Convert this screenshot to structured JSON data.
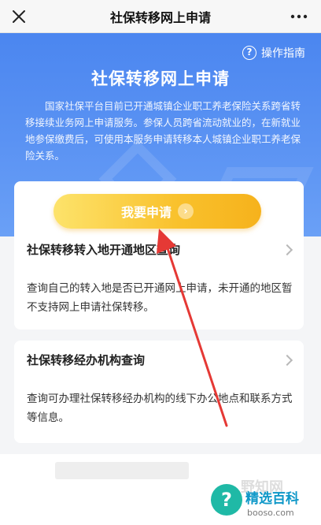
{
  "header": {
    "title": "社保转移网上申请",
    "close_icon": "close-icon",
    "more_icon": "more-icon"
  },
  "hero": {
    "guide_label": "操作指南",
    "title": "社保转移网上申请",
    "description": "国家社保平台目前已开通城镇企业职工养老保险关系跨省转移接续业务网上申请服务。参保人员跨省流动就业的，在新就业地参保缴费后，可使用本服务申请转移本人城镇企业职工养老保险关系。"
  },
  "apply_button": {
    "label": "我要申请",
    "arrow": "›"
  },
  "items": [
    {
      "title": "社保转移转入地开通地区查询",
      "desc": "查询自己的转入地是否已开通网上申请，未开通的地区暂不支持网上申请社保转移。"
    },
    {
      "title": "社保转移经办机构查询",
      "desc": "查询可办理社保转移经办机构的线下办公地点和联系方式等信息。"
    }
  ],
  "watermark": {
    "symbol": "?",
    "text": "精选百科",
    "sub": "booso.com",
    "faded": "野知网"
  },
  "colors": {
    "hero_blue": "#4b86f0",
    "button_yellow": "#f9c12c",
    "annotation_red": "#e53935"
  }
}
